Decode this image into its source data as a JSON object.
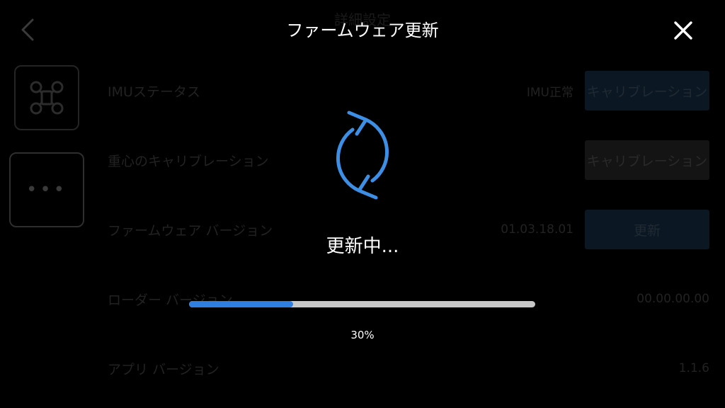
{
  "background": {
    "header_title": "詳細設定",
    "rows": [
      {
        "label": "IMUステータス",
        "value": "IMU正常",
        "button": "キャリブレーション"
      },
      {
        "label": "重心のキャリブレーション",
        "value": "",
        "button": "キャリブレーション"
      },
      {
        "label": "ファームウェア バージョン",
        "value": "01.03.18.01",
        "button": "更新"
      },
      {
        "label": "ローダー バージョン",
        "value": "00.00.00.00",
        "button": ""
      },
      {
        "label": "アプリ バージョン",
        "value": "1.1.6",
        "button": ""
      }
    ],
    "more_label": "•••"
  },
  "header": {
    "title": "ファームウェア更新"
  },
  "overlay": {
    "status_text": "更新中...",
    "progress_percent": 30,
    "progress_text": "30%",
    "accent_color": "#3d8fe6"
  },
  "icons": {
    "back": "chevron-left-icon",
    "close": "close-icon",
    "sync": "sync-icon",
    "drone": "drone-icon"
  }
}
